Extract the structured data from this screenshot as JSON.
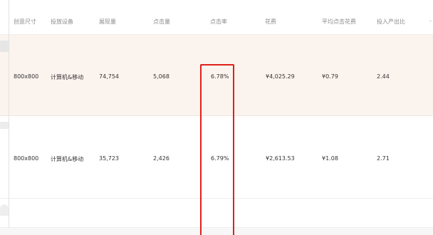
{
  "table": {
    "columns": [
      "创意尺寸",
      "投放设备",
      "展现量",
      "点击量",
      "点击率",
      "花费",
      "平均点击花费",
      "投入产出比",
      "-"
    ],
    "rows": [
      {
        "size": "800x800",
        "device": "计算机&移动",
        "impressions": "74,754",
        "clicks": "5,068",
        "ctr": "6.78%",
        "cost": "¥4,025.29",
        "avg_cpc": "¥0.79",
        "roi": "2.44"
      },
      {
        "size": "800x800",
        "device": "计算机&移动",
        "impressions": "35,723",
        "clicks": "2,426",
        "ctr": "6.79%",
        "cost": "¥2,613.53",
        "avg_cpc": "¥1.08",
        "roi": "2.71"
      }
    ]
  },
  "colors": {
    "highlight_border": "#e0201c",
    "highlighted_row_bg": "#fbf3ee",
    "header_text": "#8c8c8c"
  }
}
